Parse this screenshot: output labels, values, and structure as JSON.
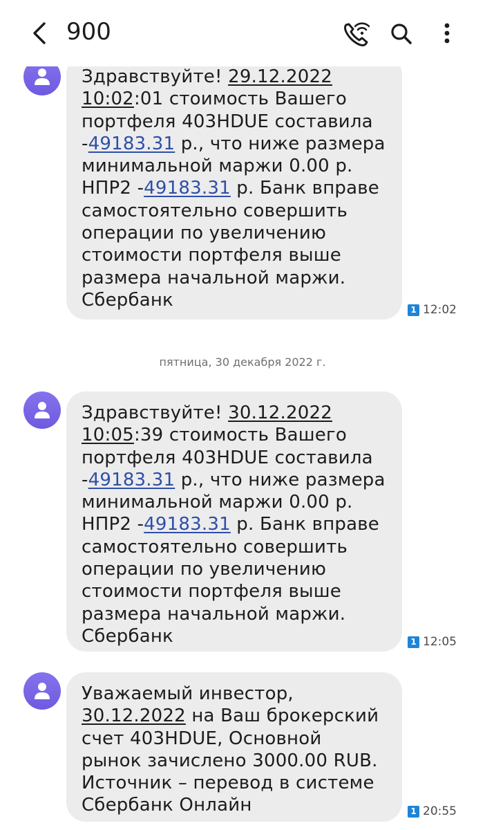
{
  "header": {
    "title": "900"
  },
  "date_separator": "пятница, 30 декабря 2022 г.",
  "messages": [
    {
      "text": [
        "Здравствуйте! ",
        "29.12.2022",
        "\n",
        "10:02",
        ":01 стоимость Вашего\nпортфеля 403HDUE составила\n-",
        "49183.31",
        " р., что ниже размера\nминимальной маржи 0.00 р.\nНПР2 -",
        "49183.31",
        " р. Банк вправе\nсамостоятельно совершить\nоперации по увеличению\nстоимости портфеля выше\nразмера начальной маржи.\nСбербанк"
      ],
      "sim": "1",
      "time": "12:02"
    },
    {
      "text": [
        "Здравствуйте! ",
        "30.12.2022",
        "\n",
        "10:05",
        ":39 стоимость Вашего\nпортфеля 403HDUE составила\n-",
        "49183.31",
        " р., что ниже размера\nминимальной маржи 0.00 р.\nНПР2 -",
        "49183.31",
        " р. Банк вправе\nсамостоятельно совершить\nоперации по увеличению\nстоимости портфеля выше\nразмера начальной маржи.\nСбербанк"
      ],
      "sim": "1",
      "time": "12:05"
    },
    {
      "text": [
        "Уважаемый инвестор,\n",
        "30.12.2022",
        " на Ваш брокерский\nсчет 403HDUE, Основной\nрынок зачислено 3000.00 RUB.\nИсточник – перевод в системе\nСбербанк Онлайн"
      ],
      "sim": "1",
      "time": "20:55"
    }
  ],
  "icons": [
    "back-arrow-icon",
    "wifi-call-icon",
    "search-icon",
    "more-vert-icon",
    "person-icon"
  ]
}
